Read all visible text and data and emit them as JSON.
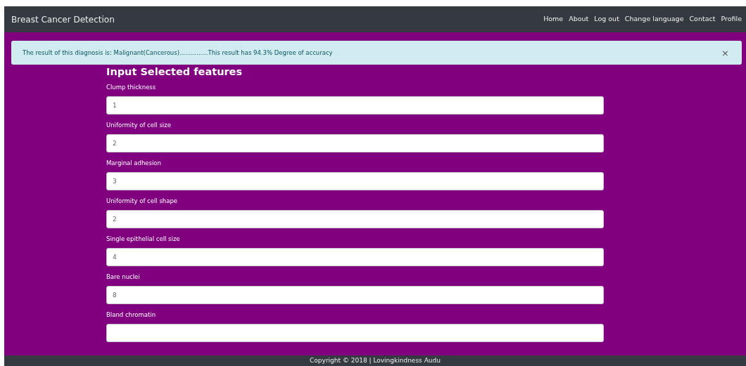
{
  "navbar": {
    "brand": "Breast Cancer Detection",
    "links": [
      {
        "label": "Home"
      },
      {
        "label": "About"
      },
      {
        "label": "Log out"
      },
      {
        "label": "Change language"
      },
      {
        "label": "Contact"
      },
      {
        "label": "Profile"
      }
    ]
  },
  "alert": {
    "message": "The result of this diagnosis is: Malignant(Cancerous)...............This result has 94.3% Degree of accuracy",
    "close": "×"
  },
  "form": {
    "heading": "Input Selected features",
    "fields": [
      {
        "label": "Clump thickness",
        "value": "1"
      },
      {
        "label": "Uniformity of cell size",
        "value": "2"
      },
      {
        "label": "Marginal adhesion",
        "value": "3"
      },
      {
        "label": "Uniformity of cell shape",
        "value": "2"
      },
      {
        "label": "Single epithelial cell size",
        "value": "4"
      },
      {
        "label": "Bare nuclei",
        "value": "8"
      },
      {
        "label": "Bland chromatin"
      }
    ]
  },
  "footer": {
    "text": "Copyright © 2018 | Lovingkindness Audu"
  }
}
